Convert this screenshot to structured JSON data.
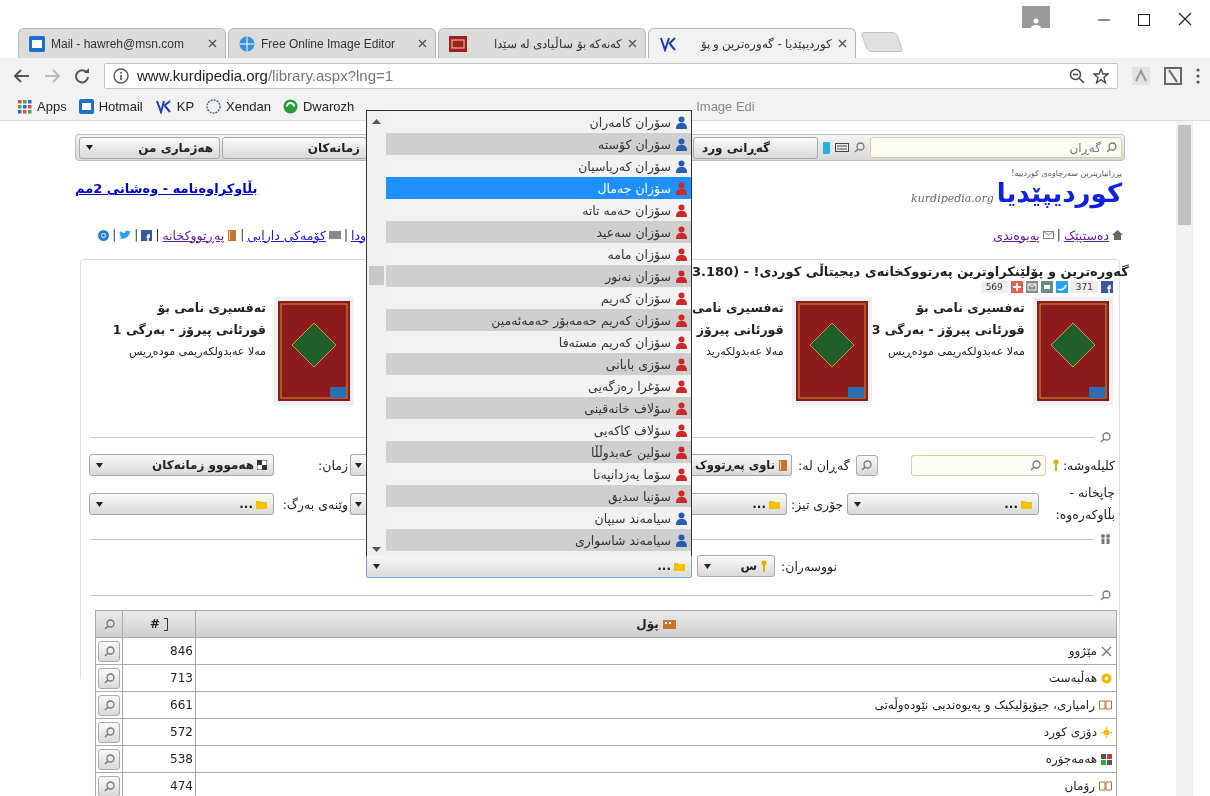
{
  "browser": {
    "tabs": [
      {
        "title": "کوردیپێدیا - گەورەترین و پۆ",
        "selected": true
      },
      {
        "title": "کەنەکە بۆ ساڵیادی لە سێدا",
        "selected": false
      },
      {
        "title": "Free Online Image Editor",
        "selected": false
      },
      {
        "title": "Mail - hawreh@msn.com",
        "selected": false
      }
    ],
    "address": {
      "host": "www.kurdipedia.org",
      "path": "/library.aspx?lng=1"
    },
    "bookmarks": [
      "Dwarozh",
      "Xendan",
      "KP",
      "Hotmail",
      "Apps"
    ],
    "bookmark_partial": "Image Edi"
  },
  "page": {
    "top_bar": {
      "account": "هەژماری من",
      "languages": "زمانەکان",
      "advanced_search": "گەڕانی ورد",
      "search_placeholder": "گەڕان"
    },
    "bulletin_link": "بڵاوکراوەنامە - وەشانی 2مم",
    "logo": {
      "name": "کوردیپێدیا",
      "domain": "kurdipedia.org",
      "tagline": "پڕزانیاریترین سەرچاوەی کوردییە!"
    },
    "left_links": [
      "ودا",
      "کۆمەکی دارایی",
      "پەڕتووکخانە"
    ],
    "separator": "|",
    "right_links": [
      "دەستپێک",
      "پەیوەندی"
    ],
    "heading": "گەورەترین و پۆلێنکراوترین پەرتووکخانەی دیجیتاڵی کوردی! - (3.180",
    "share_counts": [
      "371",
      "569"
    ],
    "books": [
      {
        "title_lines": [
          "تەفسیری نامی بۆ",
          "قورئانی پیرۆز - بەرگی 3"
        ],
        "author": "مەلا عەبدولکەریمی مودەڕیس"
      },
      {
        "title_lines": [
          "تەفسیری نامی",
          "قورئانی پیرۆز"
        ],
        "author": "مەلا عەبدولکەرید"
      },
      {
        "title_lines": [
          "تەفسیری نامی بۆ",
          "قورئانی پیرۆز - بەرگی 1"
        ],
        "author": "مەلا عەبدولکەریمی مودەڕیس"
      }
    ],
    "filters": {
      "keyword_label": "کلیلەوشە:",
      "search_in_label": "گەڕان لە:",
      "search_in_value": "ناوی پەڕتووک",
      "language_label": "زمان:",
      "language_value": "هەمووو زمانەکان",
      "publisher_label": "چاپخانە - بڵاوکەرەوە:",
      "publisher_value": "...",
      "thesis_label": "جۆری تیز:",
      "thesis_value": "...",
      "cover_label": "وێنەی بەرگ:",
      "cover_value": "...",
      "authors_label": "نووسەران:",
      "authors_letter": "س",
      "authors_value": "..."
    },
    "author_options": [
      {
        "name": "سۆران کامەران",
        "color": "#2a5db0",
        "selected": false
      },
      {
        "name": "سۆران کۆستە",
        "color": "#2a5db0",
        "selected": false
      },
      {
        "name": "سۆران کەریاسیان",
        "color": "#2a5db0",
        "selected": false
      },
      {
        "name": "سۆزان جەمال",
        "color": "#cc2a2a",
        "selected": true
      },
      {
        "name": "سۆزان حەمە تاتە",
        "color": "#cc2a2a",
        "selected": false
      },
      {
        "name": "سۆزان سەعید",
        "color": "#cc2a2a",
        "selected": false
      },
      {
        "name": "سۆزان مامە",
        "color": "#cc2a2a",
        "selected": false
      },
      {
        "name": "سۆزان نەنور",
        "color": "#cc2a2a",
        "selected": false
      },
      {
        "name": "سۆزان کەریم",
        "color": "#cc2a2a",
        "selected": false
      },
      {
        "name": "سۆزان کەریم حەمەبۆر حەمەئەمین",
        "color": "#cc2a2a",
        "selected": false
      },
      {
        "name": "سۆزان کەریم مستەفا",
        "color": "#cc2a2a",
        "selected": false
      },
      {
        "name": "سۆزی بابانی",
        "color": "#cc2a2a",
        "selected": false
      },
      {
        "name": "سۆغرا رەزگەیی",
        "color": "#cc2a2a",
        "selected": false
      },
      {
        "name": "سۆلاف خانەقینی",
        "color": "#cc2a2a",
        "selected": false
      },
      {
        "name": "سۆلاف کاکەیی",
        "color": "#cc2a2a",
        "selected": false
      },
      {
        "name": "سۆلین عەبدوڵڵا",
        "color": "#cc2a2a",
        "selected": false
      },
      {
        "name": "سۆما یەزدانپەنا",
        "color": "#cc2a2a",
        "selected": false
      },
      {
        "name": "سۆنیا سدیق",
        "color": "#cc2a2a",
        "selected": false
      },
      {
        "name": "سیامەند سیپان",
        "color": "#2a5db0",
        "selected": false
      },
      {
        "name": "سیامەند شاسواری",
        "color": "#2a5db0",
        "selected": false
      }
    ],
    "table": {
      "columns": [
        "پۆل",
        "#"
      ],
      "rows": [
        {
          "category": "مێژوو",
          "count": "846"
        },
        {
          "category": "هەڵبەست",
          "count": "713"
        },
        {
          "category": "رامیاری، جیۆپۆلیکیک و پەیوەندیی نێودەوڵەتی",
          "count": "661"
        },
        {
          "category": "دۆزی کورد",
          "count": "572"
        },
        {
          "category": "هەمەجۆرە",
          "count": "538"
        },
        {
          "category": "رۆمان",
          "count": "474"
        }
      ]
    }
  }
}
